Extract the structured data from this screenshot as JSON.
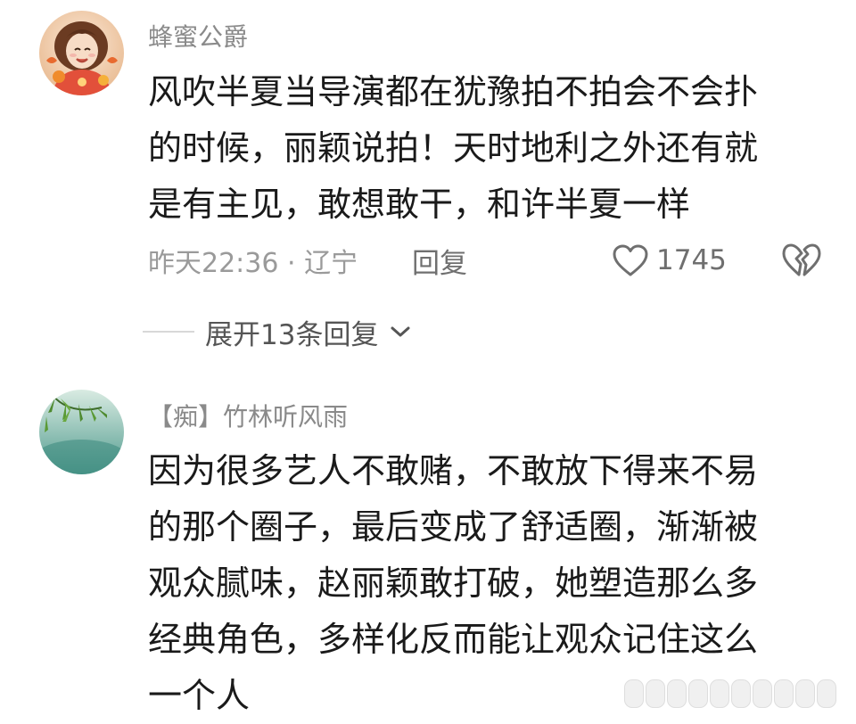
{
  "comments": [
    {
      "username": "蜂蜜公爵",
      "content_lines": [
        "风吹半夏当导演都在犹豫拍不拍会不会扑",
        "的时候，丽颖说拍！天时地利之外还有就",
        "是有主见，敢想敢干，和许半夏一样"
      ],
      "time": "昨天22:36 · 辽宁",
      "reply_label": "回复",
      "likes": "1745",
      "expand_label": "展开13条回复",
      "avatar_icon": "anime-girl-avatar-icon"
    },
    {
      "username": "【痴】竹林听风雨",
      "content_lines": [
        "因为很多艺人不敢赌，不敢放下得来不易",
        "的那个圈子，最后变成了舒适圈，渐渐被",
        "观众腻味，赵丽颖敢打破，她塑造那么多",
        "经典角色，多样化反而能让观众记住这么",
        "一个人"
      ],
      "avatar_icon": "bamboo-avatar-icon"
    }
  ],
  "icons": {
    "like": "heart-outline-icon",
    "dislike": "broken-heart-icon",
    "expand": "chevron-down-icon"
  },
  "colors": {
    "text": "#1a1a1a",
    "muted": "#9a9a9a",
    "username": "#8a8a8a"
  }
}
